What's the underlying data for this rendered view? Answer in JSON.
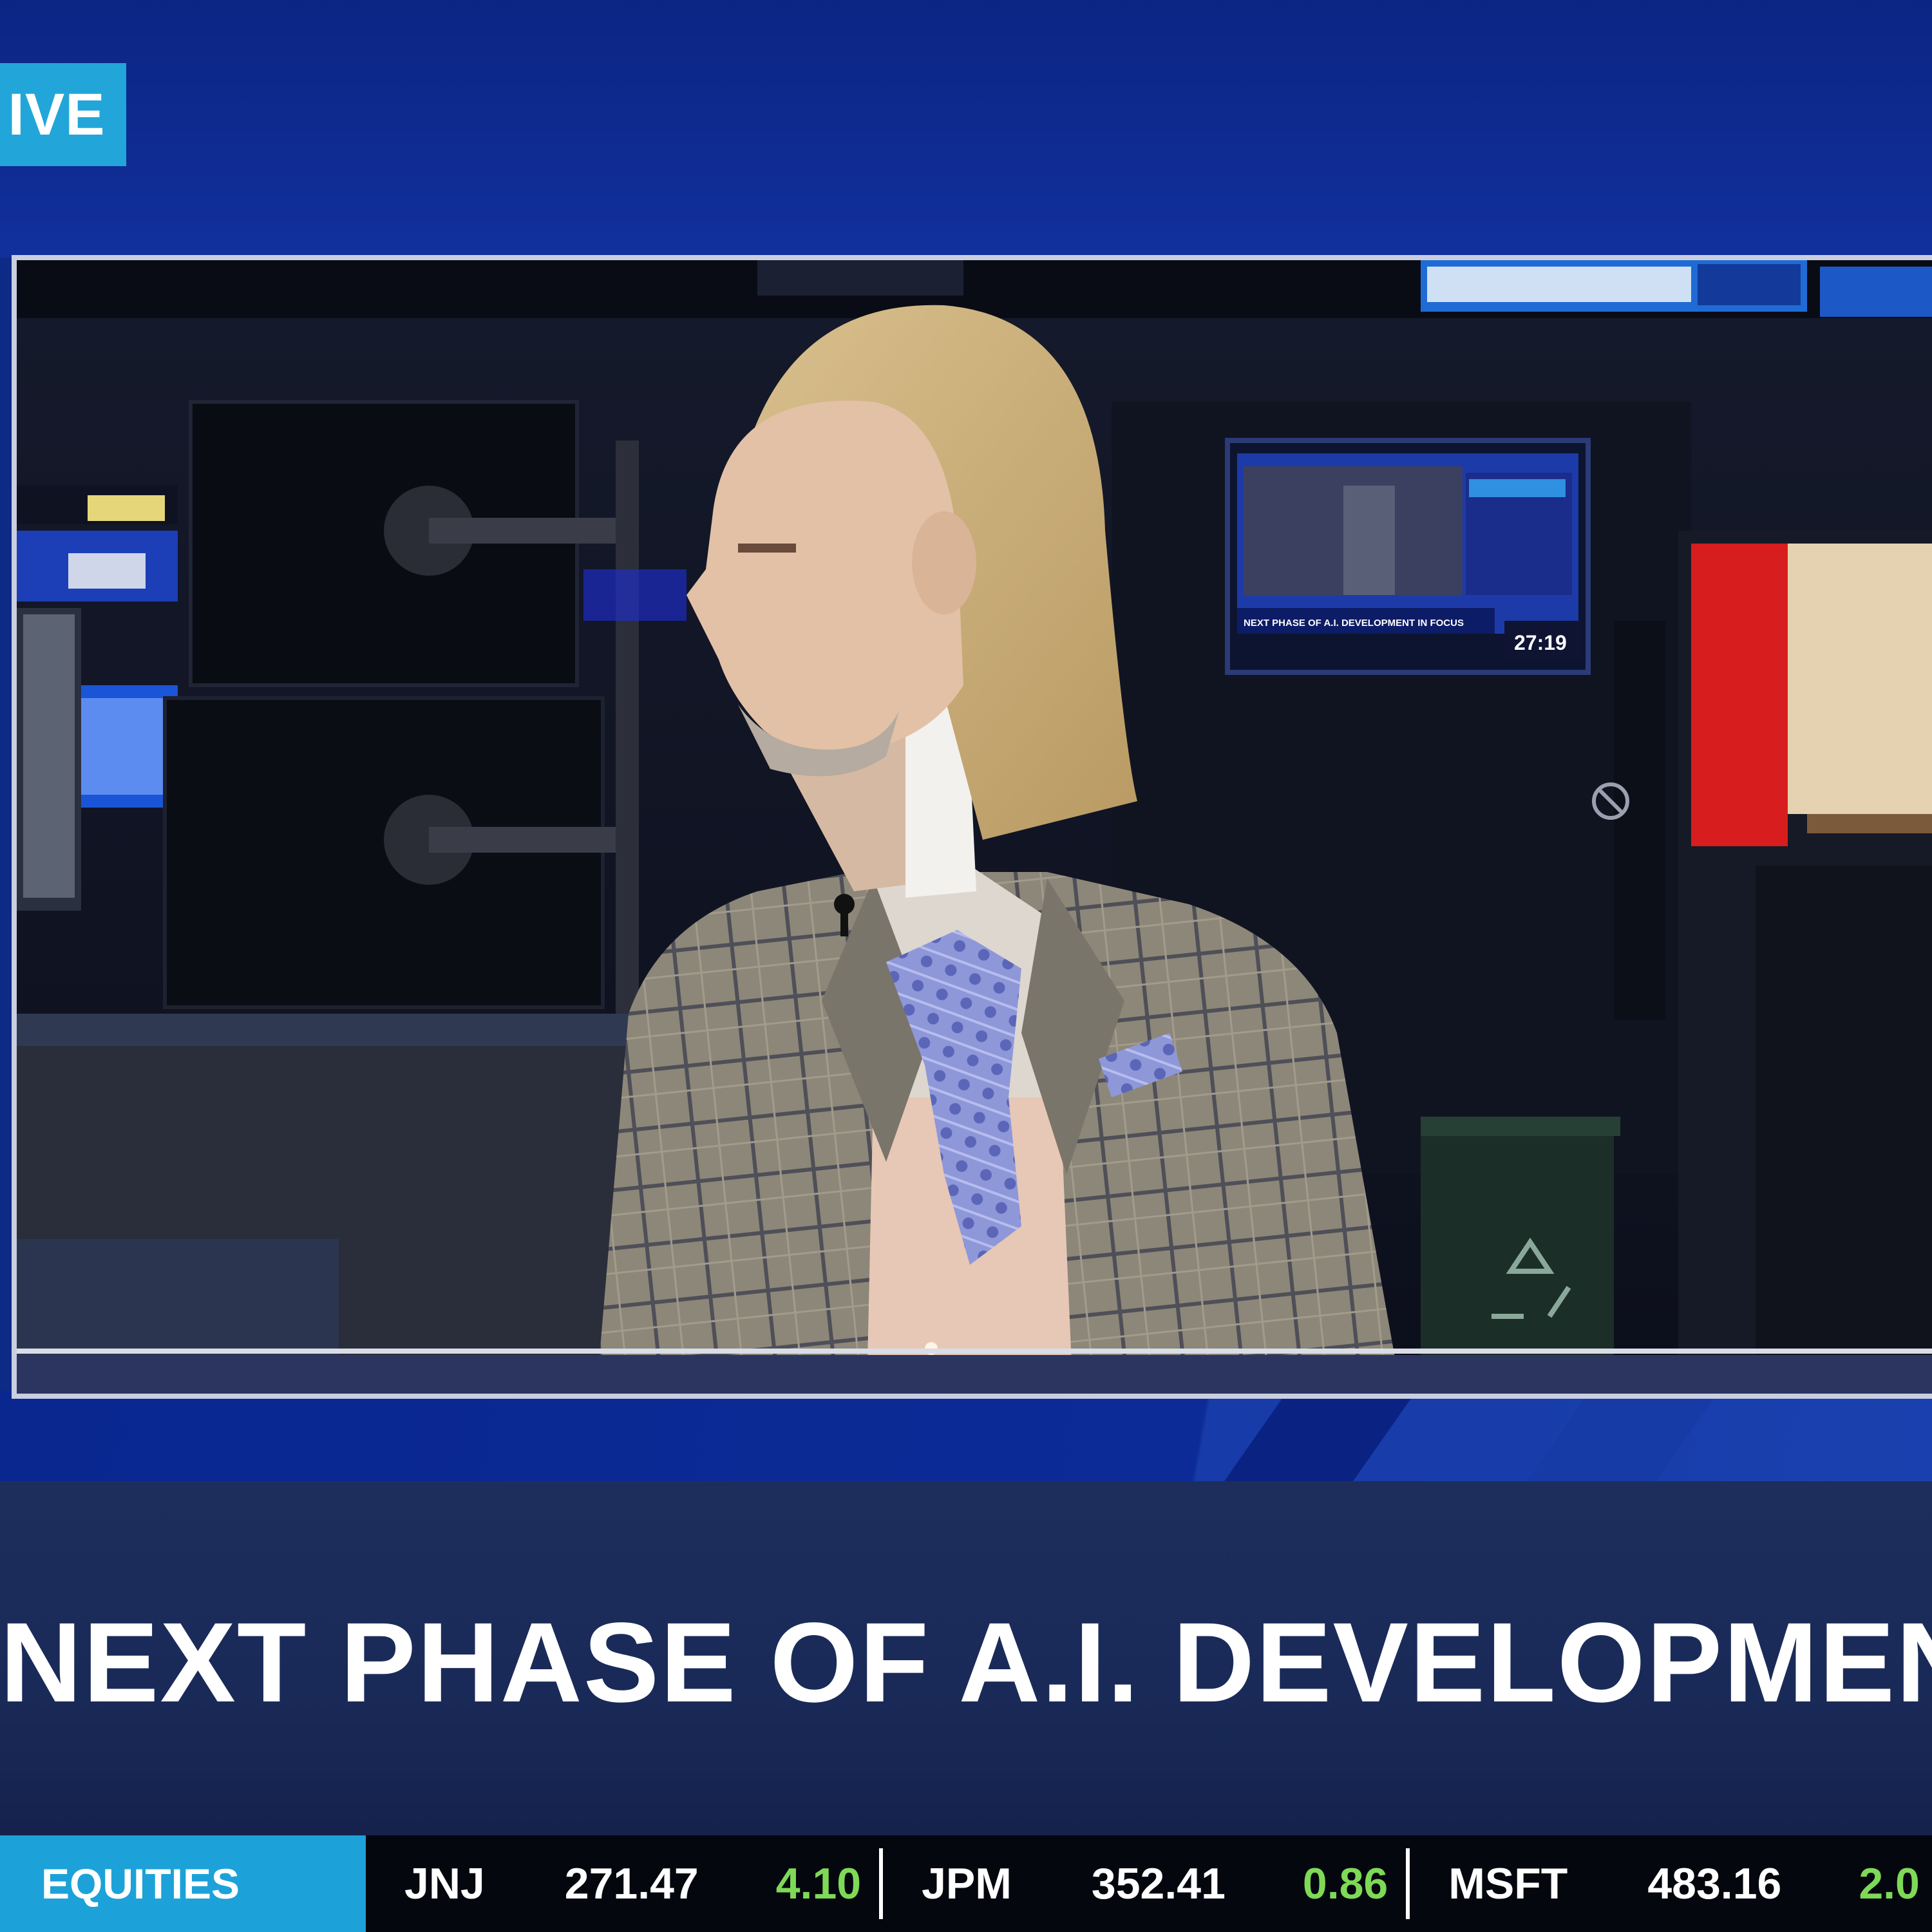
{
  "live_badge": {
    "label": "IVE"
  },
  "headline": "NEXT PHASE OF A.I. DEVELOPMENT IN",
  "in_studio_monitor": {
    "headline": "NEXT PHASE OF A.I. DEVELOPMENT IN FOCUS",
    "clock": "27:19"
  },
  "ticker": {
    "label": "EQUITIES",
    "items": [
      {
        "symbol": "JNJ",
        "price": "271.47",
        "change": "4.10"
      },
      {
        "symbol": "JPM",
        "price": "352.41",
        "change": "0.86"
      },
      {
        "symbol": "MSFT",
        "price": "483.16",
        "change": "2.0"
      }
    ],
    "up_color": "#7ed957"
  },
  "colors": {
    "brand_blue": "#0d2a86",
    "accent_cyan": "#1ca2d8",
    "lower_third": "#1e2e5c"
  },
  "icons": [
    "recycle-icon",
    "no-smoking-icon",
    "lapel-microphone"
  ]
}
